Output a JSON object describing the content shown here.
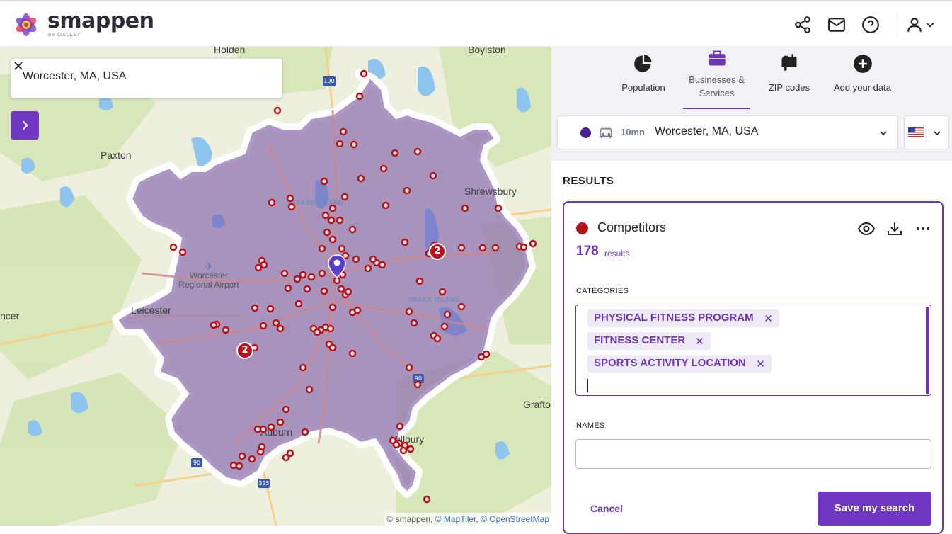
{
  "header": {
    "brand": "smappen",
    "brand_sub": "ex OALLEY",
    "icons": [
      "share-icon",
      "mail-icon",
      "help-icon",
      "user-icon",
      "chevron-down-icon"
    ]
  },
  "map": {
    "search": {
      "value": "Worcester, MA, USA"
    },
    "labels": {
      "holden": "Holden",
      "boylston": "Boylston",
      "paxton": "Paxton",
      "shrewsbury": "Shrewsbury",
      "leicester": "Leicester",
      "spencer": "ncer",
      "grafton": "Grafto",
      "auburn": "Auburn",
      "millbury": "Millbury",
      "airport_line1": "Worcester",
      "airport_line2": "Regional Airport",
      "sears_island": "SEARS ISLAND",
      "drake_island": "DRAKE ISLAND"
    },
    "highway_shields": [
      "190",
      "90",
      "90",
      "395"
    ],
    "clusters": [
      "2",
      "2"
    ],
    "attribution": {
      "smappen": "© smappen,",
      "maptiler": "© MapTiler,",
      "osm": "© OpenStreetMap"
    },
    "colors": {
      "zone_fill": "#8e6fb0",
      "marker": "#b3141b",
      "center_pin": "#5b3ec8"
    }
  },
  "panel": {
    "tabs": [
      {
        "label": "Population",
        "icon": "pie-chart-icon"
      },
      {
        "label": "Businesses & Services",
        "icon": "briefcase-icon",
        "active": true
      },
      {
        "label": "ZIP codes",
        "icon": "mailbox-icon"
      },
      {
        "label": "Add your data",
        "icon": "plus-circle-icon"
      }
    ],
    "area": {
      "time": "10mn",
      "name": "Worcester, MA, USA",
      "mode_icon": "car-icon",
      "color": "#4a1d96"
    },
    "country_flag": "us-flag-icon",
    "results_title": "RESULTS",
    "card": {
      "title": "Competitors",
      "count": "178",
      "count_label": "results",
      "color": "#b3141b",
      "categories_label": "CATEGORIES",
      "categories": [
        "PHYSICAL FITNESS PROGRAM",
        "FITNESS CENTER",
        "SPORTS ACTIVITY LOCATION"
      ],
      "names_label": "NAMES",
      "names_value": "",
      "cancel_label": "Cancel",
      "save_label": "Save my search"
    },
    "accent": "#6b35b8"
  }
}
